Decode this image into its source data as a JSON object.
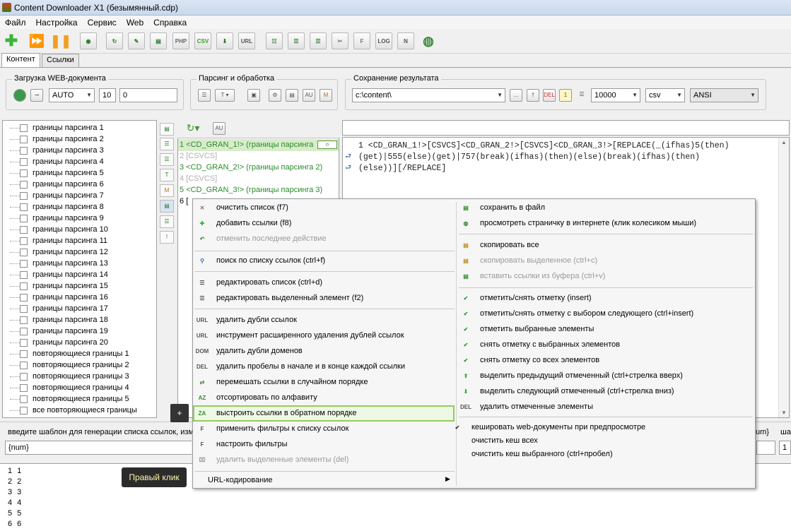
{
  "window": {
    "title": "Content Downloader X1 (безымянный.cdp)"
  },
  "menubar": [
    "Файл",
    "Настройка",
    "Сервис",
    "Web",
    "Справка"
  ],
  "tabs": [
    "Контент",
    "Ссылки"
  ],
  "load_group": {
    "title": "Загрузка WEB-документа",
    "mode": "AUTO",
    "threads": "10",
    "delay": "0"
  },
  "parse_group": {
    "title": "Парсинг и обработка"
  },
  "save_group": {
    "title": "Сохранение результата",
    "path": "c:\\content\\",
    "count": "10000",
    "format": "csv",
    "encoding": "ANSI",
    "btn_more": "...",
    "btn_f": "f",
    "btn_1": "1"
  },
  "tree": [
    "границы парсинга 1",
    "границы парсинга 2",
    "границы парсинга 3",
    "границы парсинга 4",
    "границы парсинга 5",
    "границы парсинга 6",
    "границы парсинга 7",
    "границы парсинга 8",
    "границы парсинга 9",
    "границы парсинга 10",
    "границы парсинга 11",
    "границы парсинга 12",
    "границы парсинга 13",
    "границы парсинга 14",
    "границы парсинга 15",
    "границы парсинга 16",
    "границы парсинга 17",
    "границы парсинга 18",
    "границы парсинга 19",
    "границы парсинга 20",
    "повторяющиеся границы 1",
    "повторяющиеся границы 2",
    "повторяющиеся границы 3",
    "повторяющиеся границы 4",
    "повторяющиеся границы 5",
    "все повторяющиеся границы"
  ],
  "link_rows": [
    {
      "num": "1",
      "text": "<CD_GRAN_1!> (границы парсинга",
      "color": "#2a8a2a"
    },
    {
      "num": "2",
      "text": "[CSVCS]",
      "color": "#b0b0b0"
    },
    {
      "num": "3",
      "text": "<CD_GRAN_2!> (границы парсинга 2)",
      "color": "#2a8a2a"
    },
    {
      "num": "4",
      "text": "[CSVCS]",
      "color": "#b0b0b0"
    },
    {
      "num": "5",
      "text": "<CD_GRAN_3!> (границы парсинга 3)",
      "color": "#2a8a2a"
    },
    {
      "num": "6",
      "text": "[",
      "color": "#000"
    }
  ],
  "editor": {
    "line1": "1 <CD_GRAN_1!>[CSVCS]<CD_GRAN_2!>[CSVCS]<CD_GRAN_3!>[REPLACE(_(ifhas)5(then)",
    "line2": "(get)|555(else)(get)|757(break)(ifhas)(then)(else)(break)(ifhas)(then)",
    "line3": "(else))][/REPLACE]"
  },
  "template": {
    "label": "введите шаблон для генерации списка ссылок, изм",
    "value": "{num}",
    "right_label1": "um}",
    "right_label2": "шаг",
    "right_value": "1"
  },
  "bottom_list": [
    {
      "a": "1",
      "b": "1"
    },
    {
      "a": "2",
      "b": "2"
    },
    {
      "a": "3",
      "b": "3"
    },
    {
      "a": "4",
      "b": "4"
    },
    {
      "a": "5",
      "b": "5"
    },
    {
      "a": "6",
      "b": "6"
    }
  ],
  "tooltip": "Правый клик",
  "plus_label": "+",
  "context_menu": {
    "left": [
      {
        "icon": "x-icon",
        "label": "очистить список (f7)",
        "disabled": false
      },
      {
        "icon": "plus-icon",
        "label": "добавить ссылки (f8)",
        "disabled": false
      },
      {
        "icon": "undo-icon",
        "label": "отменить последнее действие",
        "disabled": true
      },
      {
        "icon": "search-icon",
        "label": "поиск по списку ссылок (ctrl+f)",
        "disabled": false
      },
      {
        "icon": "list-icon",
        "label": "редактировать список (ctrl+d)",
        "disabled": false
      },
      {
        "icon": "edit-icon",
        "label": "редактировать выделенный элемент (f2)",
        "disabled": false
      },
      {
        "icon": "url-icon",
        "label": "удалить дубли ссылок",
        "disabled": false
      },
      {
        "icon": "url-icon",
        "label": "инструмент расширенного удаления дублей ссылок",
        "disabled": false
      },
      {
        "icon": "dom-icon",
        "label": "удалить дубли доменов",
        "disabled": false
      },
      {
        "icon": "del-icon",
        "label": "удалить пробелы в начале и в конце каждой ссылки",
        "disabled": false
      },
      {
        "icon": "shuffle-icon",
        "label": "перемешать ссылки в случайном порядке",
        "disabled": false
      },
      {
        "icon": "sort-az-icon",
        "label": "отсортировать по алфавиту",
        "disabled": false
      },
      {
        "icon": "sort-za-icon",
        "label": "выстроить ссылки в обратном порядке",
        "disabled": false
      },
      {
        "icon": "filter-icon",
        "label": "применить фильтры к списку ссылок",
        "disabled": false
      },
      {
        "icon": "filter-settings-icon",
        "label": "настроить фильтры",
        "disabled": false
      },
      {
        "icon": "delete-icon",
        "label": "удалить выделенные элементы (del)",
        "disabled": true
      },
      {
        "icon": "",
        "label": "URL-кодирование",
        "disabled": false
      }
    ],
    "right": [
      {
        "icon": "save-icon",
        "label": "сохранить в файл",
        "disabled": false
      },
      {
        "icon": "globe-icon",
        "label": "просмотреть страничку в интернете (клик колесиком мыши)",
        "disabled": false
      },
      {
        "icon": "copy-icon",
        "label": "скопировать все",
        "disabled": false
      },
      {
        "icon": "copy-icon",
        "label": "скопировать выделенное (ctrl+c)",
        "disabled": true
      },
      {
        "icon": "paste-icon",
        "label": "вставить ссылки из буфера (ctrl+v)",
        "disabled": true
      },
      {
        "icon": "check-icon",
        "label": "отметить/снять отметку (insert)",
        "disabled": false
      },
      {
        "icon": "check-icon",
        "label": "отметить/снять отметку с выбором следующего (ctrl+insert)",
        "disabled": false
      },
      {
        "icon": "check-icon",
        "label": "отметить выбранные элементы",
        "disabled": false
      },
      {
        "icon": "uncheck-icon",
        "label": "снять отметку с выбранных элементов",
        "disabled": false
      },
      {
        "icon": "uncheck-icon",
        "label": "снять отметку со всех элементов",
        "disabled": false
      },
      {
        "icon": "arrow-up-icon",
        "label": "выделить предыдущий отмеченный (ctrl+стрелка вверх)",
        "disabled": false
      },
      {
        "icon": "arrow-down-icon",
        "label": "выделить следующий отмеченный (ctrl+стрелка вниз)",
        "disabled": false
      },
      {
        "icon": "del-icon",
        "label": "удалить отмеченные элементы",
        "disabled": false
      },
      {
        "icon": "checkmark-icon",
        "label": "кешировать web-документы при предпросмотре",
        "disabled": false
      },
      {
        "icon": "",
        "label": "очистить кеш всех",
        "disabled": false
      },
      {
        "icon": "",
        "label": "очистить кеш выбранного (ctrl+пробел)",
        "disabled": false
      }
    ]
  }
}
